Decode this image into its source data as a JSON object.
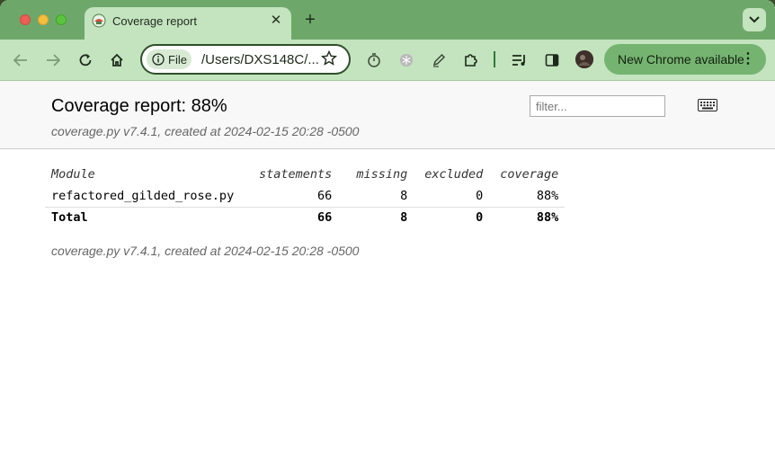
{
  "browser": {
    "tab_title": "Coverage report",
    "file_chip_label": "File",
    "url": "/Users/DXS148C/...",
    "update_button_label": "New Chrome available",
    "theme_color": "#6da86a"
  },
  "report": {
    "title": "Coverage report: 88%",
    "created": "coverage.py v7.4.1, created at 2024-02-15 20:28 -0500",
    "filter_placeholder": "filter...",
    "columns": [
      "Module",
      "statements",
      "missing",
      "excluded",
      "coverage"
    ],
    "rows": [
      {
        "module": "refactored_gilded_rose.py",
        "statements": "66",
        "missing": "8",
        "excluded": "0",
        "coverage": "88%"
      }
    ],
    "total": {
      "module": "Total",
      "statements": "66",
      "missing": "8",
      "excluded": "0",
      "coverage": "88%"
    },
    "footer_created": "coverage.py v7.4.1, created at 2024-02-15 20:28 -0500"
  },
  "icons": [
    "close-window",
    "minimize-window",
    "maximize-window",
    "favicon",
    "tab-close",
    "new-tab",
    "tab-menu-chevron",
    "back-arrow",
    "forward-arrow",
    "reload",
    "home",
    "info",
    "bookmark-star",
    "timer",
    "extension-snowflake",
    "pen",
    "puzzle-extension",
    "reading-list",
    "side-panel",
    "profile-avatar",
    "more-dots",
    "keyboard"
  ]
}
